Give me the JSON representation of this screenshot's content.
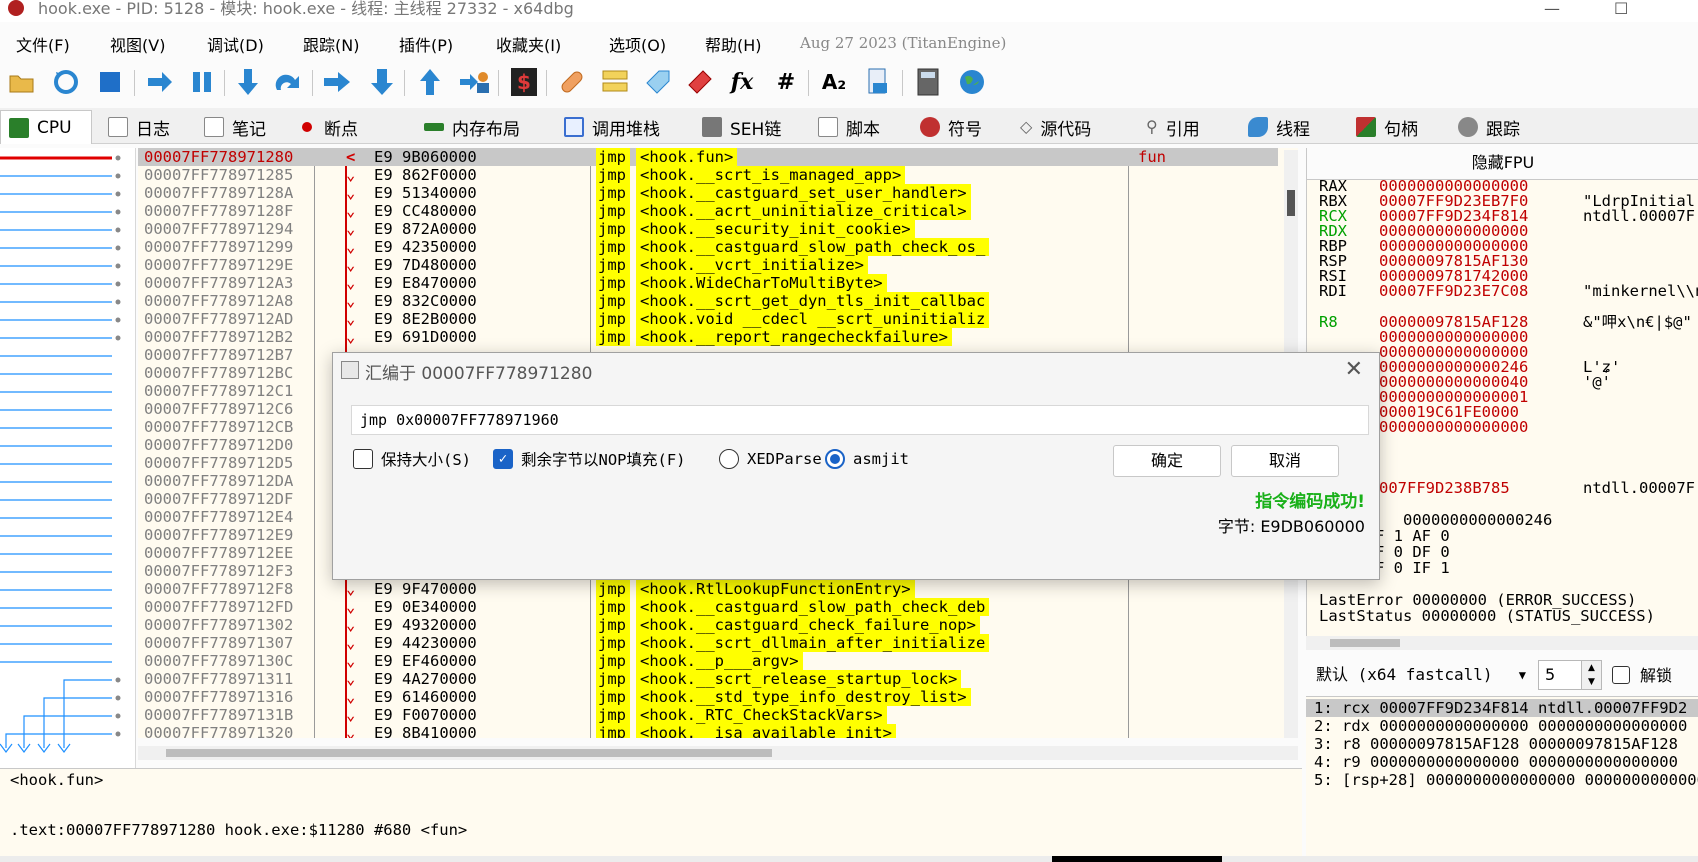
{
  "window": {
    "title": "hook.exe - PID: 5128 - 模块: hook.exe - 线程: 主线程 27332 - x64dbg",
    "minimize": "—",
    "maximize": "☐"
  },
  "menu": {
    "items": [
      "文件(F)",
      "视图(V)",
      "调试(D)",
      "跟踪(N)",
      "插件(P)",
      "收藏夹(I)",
      "选项(O)",
      "帮助(H)"
    ],
    "date": "Aug 27 2023 (TitanEngine)"
  },
  "toolbar": {
    "icons": [
      "open-icon",
      "restart-icon",
      "stop-icon",
      "run-icon",
      "pause-icon",
      "step-into-icon",
      "step-over-icon",
      "run-to-user-icon",
      "execute-till-return-icon",
      "run-to-selection-icon",
      "animate-icon",
      "script-icon",
      "patch-icon",
      "comment-icon",
      "label-icon",
      "bookmark-icon",
      "function-icon",
      "hash-icon",
      "font-icon",
      "calculator-icon",
      "memory-icon",
      "globe-icon"
    ],
    "fx_label": "fx",
    "hash_label": "#",
    "font_label": "A₂",
    "script_label": "$"
  },
  "tabs": [
    {
      "label": "CPU",
      "color": "#2a7f2a"
    },
    {
      "label": "日志",
      "color": "#888888"
    },
    {
      "label": "笔记",
      "color": "#888888"
    },
    {
      "label": "断点",
      "color": "#d00000"
    },
    {
      "label": "内存布局",
      "color": "#2a7f2a"
    },
    {
      "label": "调用堆栈",
      "color": "#3a6ed0"
    },
    {
      "label": "SEH链",
      "color": "#666666"
    },
    {
      "label": "脚本",
      "color": "#888888"
    },
    {
      "label": "符号",
      "color": "#c03030"
    },
    {
      "label": "源代码",
      "color": "#666666"
    },
    {
      "label": "引用",
      "color": "#666666"
    },
    {
      "label": "线程",
      "color": "#3a8ad0"
    },
    {
      "label": "句柄",
      "color": "#c03030"
    },
    {
      "label": "跟踪",
      "color": "#666666"
    }
  ],
  "disasm": {
    "rows": [
      {
        "addr": "00007FF778971280",
        "mark": "<",
        "bytes": "E9 9B060000",
        "mnem": "jmp",
        "oper": "<hook.fun>",
        "cmt": "fun",
        "selected": true
      },
      {
        "addr": "00007FF778971285",
        "mark": "",
        "bytes": "E9 862F0000",
        "mnem": "jmp",
        "oper": "<hook.__scrt_is_managed_app>",
        "cmt": ""
      },
      {
        "addr": "00007FF77897128A",
        "mark": "",
        "bytes": "E9 51340000",
        "mnem": "jmp",
        "oper": "<hook.__castguard_set_user_handler>",
        "cmt": ""
      },
      {
        "addr": "00007FF77897128F",
        "mark": "",
        "bytes": "E9 CC480000",
        "mnem": "jmp",
        "oper": "<hook.__acrt_uninitialize_critical>",
        "cmt": ""
      },
      {
        "addr": "00007FF778971294",
        "mark": "",
        "bytes": "E9 872A0000",
        "mnem": "jmp",
        "oper": "<hook.__security_init_cookie>",
        "cmt": ""
      },
      {
        "addr": "00007FF778971299",
        "mark": "",
        "bytes": "E9 42350000",
        "mnem": "jmp",
        "oper": "<hook.__castguard_slow_path_check_os_",
        "cmt": ""
      },
      {
        "addr": "00007FF77897129E",
        "mark": "",
        "bytes": "E9 7D480000",
        "mnem": "jmp",
        "oper": "<hook.__vcrt_initialize>",
        "cmt": ""
      },
      {
        "addr": "00007FF7789712A3",
        "mark": "",
        "bytes": "E9 E8470000",
        "mnem": "jmp",
        "oper": "<hook.WideCharToMultiByte>",
        "cmt": ""
      },
      {
        "addr": "00007FF7789712A8",
        "mark": "",
        "bytes": "E9 832C0000",
        "mnem": "jmp",
        "oper": "<hook.__scrt_get_dyn_tls_init_callbac",
        "cmt": ""
      },
      {
        "addr": "00007FF7789712AD",
        "mark": "",
        "bytes": "E9 8E2B0000",
        "mnem": "jmp",
        "oper": "<hook.void __cdecl __scrt_uninitializ",
        "cmt": ""
      },
      {
        "addr": "00007FF7789712B2",
        "mark": "",
        "bytes": "E9 691D0000",
        "mnem": "jmp",
        "oper": "<hook.__report_rangecheckfailure>",
        "cmt": ""
      },
      {
        "addr": "00007FF7789712B7",
        "mark": "",
        "bytes": "",
        "mnem": "",
        "oper": "",
        "cmt": ""
      },
      {
        "addr": "00007FF7789712BC",
        "mark": "",
        "bytes": "",
        "mnem": "",
        "oper": "",
        "cmt": ""
      },
      {
        "addr": "00007FF7789712C1",
        "mark": "",
        "bytes": "",
        "mnem": "",
        "oper": "",
        "cmt": ""
      },
      {
        "addr": "00007FF7789712C6",
        "mark": "",
        "bytes": "",
        "mnem": "",
        "oper": "",
        "cmt": ""
      },
      {
        "addr": "00007FF7789712CB",
        "mark": "",
        "bytes": "",
        "mnem": "",
        "oper": "",
        "cmt": ""
      },
      {
        "addr": "00007FF7789712D0",
        "mark": "",
        "bytes": "",
        "mnem": "",
        "oper": "",
        "cmt": ""
      },
      {
        "addr": "00007FF7789712D5",
        "mark": "",
        "bytes": "",
        "mnem": "",
        "oper": "",
        "cmt": ""
      },
      {
        "addr": "00007FF7789712DA",
        "mark": "",
        "bytes": "",
        "mnem": "",
        "oper": "",
        "cmt": ""
      },
      {
        "addr": "00007FF7789712DF",
        "mark": "",
        "bytes": "",
        "mnem": "",
        "oper": "",
        "cmt": ""
      },
      {
        "addr": "00007FF7789712E4",
        "mark": "",
        "bytes": "",
        "mnem": "",
        "oper": "",
        "cmt": ""
      },
      {
        "addr": "00007FF7789712E9",
        "mark": "",
        "bytes": "",
        "mnem": "",
        "oper": "",
        "cmt": ""
      },
      {
        "addr": "00007FF7789712EE",
        "mark": "",
        "bytes": "",
        "mnem": "",
        "oper": "",
        "cmt": ""
      },
      {
        "addr": "00007FF7789712F3",
        "mark": "",
        "bytes": "",
        "mnem": "",
        "oper": "",
        "cmt": ""
      },
      {
        "addr": "00007FF7789712F8",
        "mark": "",
        "bytes": "E9 9F470000",
        "mnem": "jmp",
        "oper": "<hook.RtlLookupFunctionEntry>",
        "cmt": ""
      },
      {
        "addr": "00007FF7789712FD",
        "mark": "",
        "bytes": "E9 0E340000",
        "mnem": "jmp",
        "oper": "<hook.__castguard_slow_path_check_deb",
        "cmt": ""
      },
      {
        "addr": "00007FF778971302",
        "mark": "",
        "bytes": "E9 49320000",
        "mnem": "jmp",
        "oper": "<hook.__castguard_check_failure_nop>",
        "cmt": ""
      },
      {
        "addr": "00007FF778971307",
        "mark": "",
        "bytes": "E9 44230000",
        "mnem": "jmp",
        "oper": "<hook.__scrt_dllmain_after_initialize",
        "cmt": ""
      },
      {
        "addr": "00007FF77897130C",
        "mark": "",
        "bytes": "E9 EF460000",
        "mnem": "jmp",
        "oper": "<hook.__p___argv>",
        "cmt": ""
      },
      {
        "addr": "00007FF778971311",
        "mark": "",
        "bytes": "E9 4A270000",
        "mnem": "jmp",
        "oper": "<hook.__scrt_release_startup_lock>",
        "cmt": ""
      },
      {
        "addr": "00007FF778971316",
        "mark": "",
        "bytes": "E9 61460000",
        "mnem": "jmp",
        "oper": "<hook.__std_type_info_destroy_list>",
        "cmt": ""
      },
      {
        "addr": "00007FF77897131B",
        "mark": "",
        "bytes": "E9 F0070000",
        "mnem": "jmp",
        "oper": "<hook._RTC_CheckStackVars>",
        "cmt": ""
      },
      {
        "addr": "00007FF778971320",
        "mark": "",
        "bytes": "E9 8B410000",
        "mnem": "jmp",
        "oper": "<hook.__isa_available_init>",
        "cmt": ""
      }
    ]
  },
  "info": {
    "line1": "<hook.fun>",
    "line2": ".text:00007FF778971280 hook.exe:$11280 #680 <fun>"
  },
  "registers": {
    "header": "隐藏FPU",
    "rows": [
      {
        "name": "RAX",
        "val": "0000000000000000",
        "cmt": "",
        "green": false
      },
      {
        "name": "RBX",
        "val": "00007FF9D23EB7F0",
        "cmt": "\"LdrpInitial",
        "green": false
      },
      {
        "name": "RCX",
        "val": "00007FF9D234F814",
        "cmt": "ntdll.00007F",
        "green": true
      },
      {
        "name": "RDX",
        "val": "0000000000000000",
        "cmt": "",
        "green": true
      },
      {
        "name": "RBP",
        "val": "0000000000000000",
        "cmt": "",
        "green": false
      },
      {
        "name": "RSP",
        "val": "00000097815AF130",
        "cmt": "",
        "green": false
      },
      {
        "name": "RSI",
        "val": "0000009781742000",
        "cmt": "",
        "green": false
      },
      {
        "name": "RDI",
        "val": "00007FF9D23E7C08",
        "cmt": "\"minkernel\\\\n",
        "green": false
      },
      {
        "name": "R8",
        "val": "00000097815AF128",
        "cmt": "&\"呷x\\n€|$@\"",
        "green": true
      }
    ],
    "hidden_vals": [
      "0000000000000000",
      "0000000000000000",
      "0000000000000246",
      "0000000000000040",
      "0000000000000001",
      "000019C61FE0000",
      "0000000000000000"
    ],
    "hidden_cmts": [
      "",
      "",
      "L'ʑ'",
      "'@'",
      "",
      "",
      ""
    ],
    "rip_val": "007FF9D238B785",
    "rip_cmt": "ntdll.00007F",
    "rflags": "0000000000000246",
    "flags": [
      "F  1   AF  0",
      "F  0   DF  0",
      "F  0   IF  1"
    ],
    "last_error": "LastError   00000000 (ERROR_SUCCESS)",
    "last_status": "LastStatus  00000000 (STATUS_SUCCESS)"
  },
  "callconv": {
    "selected": "默认 (x64 fastcall)",
    "count": "5",
    "lock_label": "解锁"
  },
  "stack_args": [
    "1: rcx 00007FF9D234F814 ntdll.00007FF9D2",
    "2: rdx 0000000000000000 0000000000000000",
    "3: r8 00000097815AF128 00000097815AF128",
    "4: r9 0000000000000000 0000000000000000",
    "5: [rsp+28] 0000000000000000 0000000000000"
  ],
  "dialog": {
    "title": "汇编于 00007FF778971280",
    "close": "✕",
    "input_value": "jmp 0x00007FF778971960",
    "keep_size": "保持大小(S)",
    "fill_nop": "剩余字节以NOP填充(F)",
    "xedparse": "XEDParse",
    "asmjit": "asmjit",
    "ok": "确定",
    "cancel": "取消",
    "success": "指令编码成功!",
    "bytes": "字节: E9DB060000"
  }
}
